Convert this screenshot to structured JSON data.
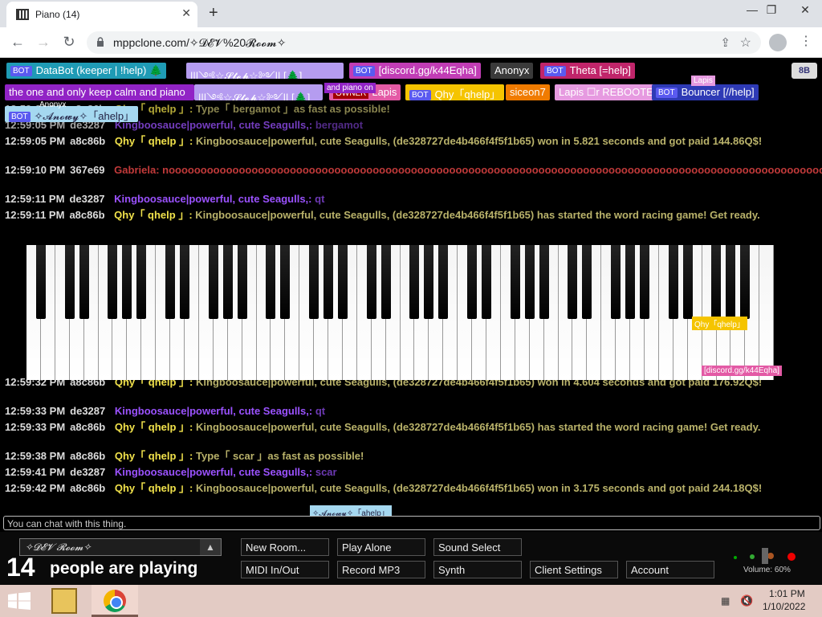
{
  "browser": {
    "tab_title": "Piano (14)",
    "tab_close": "✕",
    "new_tab": "+",
    "minimize": "—",
    "maximize": "❐",
    "close": "✕",
    "back": "←",
    "forward": "→",
    "reload": "↻",
    "url": "mppclone.com/✧𝓓𝓔𝓥%20𝓡𝓸𝓸𝓶✧",
    "share": "⇪",
    "bookmark": "☆",
    "menu": "⋮"
  },
  "players": {
    "databot": "DataBot (keeper | !help) 🌲",
    "step": "|||༺☆𝓢𝓽𝓮𝓹☆༻|| [🌲]",
    "discord": "[discord.gg/k44Eqha]",
    "anonyx": "Anonyx",
    "theta": "Theta [=help]",
    "the_one": "the one and only keep calm and piano",
    "owner_badge": "OWNER",
    "lapis": "Lapis",
    "qhy": "Qhy「qhelp」",
    "siceon": "siceon7",
    "lapis2": "Lapis ☐r REBOOTED",
    "bouncer": "Bouncer [//help]",
    "anowy": "✧𝓐𝓷𝓸𝔀𝔂✧「ahelp」",
    "bot_badge": "BOT",
    "bb": "8B"
  },
  "chat": {
    "lines": [
      {
        "time": "12:59:04 PM",
        "id": "a8c86b",
        "name": "Qhy「 qhelp 」:",
        "text": "Type「 bergamot 」as fast as possible!"
      },
      {
        "time": "12:59:05 PM",
        "id": "de3287",
        "name": "Kingboosauce|powerful, cute Seagulls,:",
        "text": "bergamot"
      },
      {
        "time": "12:59:05 PM",
        "id": "a8c86b",
        "name": "Qhy「 qhelp 」:",
        "text": "Kingboosauce|powerful, cute Seagulls, (de328727de4b466f4f5f1b65) won in 5.821 seconds and got paid 144.86Q$!"
      },
      {
        "time": "12:59:10 PM",
        "id": "367e69",
        "name": "Gabriela:",
        "text": "nooooooooooooooooooooooooooooooooooooooooooooooooooooooooooooooooooooooooooooooooooooooooooooooooooooooooooooo"
      },
      {
        "time": "12:59:11 PM",
        "id": "de3287",
        "name": "Kingboosauce|powerful, cute Seagulls,:",
        "text": "qt"
      },
      {
        "time": "12:59:11 PM",
        "id": "a8c86b",
        "name": "Qhy「 qhelp 」:",
        "text": "Kingboosauce|powerful, cute Seagulls, (de328727de4b466f4f5f1b65) has started the word racing game! Get ready."
      },
      {
        "time": "12:59:32 PM",
        "id": "a8c86b",
        "name": "Qhy「 qhelp 」:",
        "text": "Kingboosauce|powerful, cute Seagulls, (de328727de4b466f4f5f1b65) won in 4.604 seconds and got paid 176.92Q$!"
      },
      {
        "time": "12:59:33 PM",
        "id": "de3287",
        "name": "Kingboosauce|powerful, cute Seagulls,:",
        "text": "qt"
      },
      {
        "time": "12:59:33 PM",
        "id": "a8c86b",
        "name": "Qhy「 qhelp 」:",
        "text": "Kingboosauce|powerful, cute Seagulls, (de328727de4b466f4f5f1b65) has started the word racing game! Get ready."
      },
      {
        "time": "12:59:38 PM",
        "id": "a8c86b",
        "name": "Qhy「 qhelp 」:",
        "text": "Type「 scar 」as fast as possible!"
      },
      {
        "time": "12:59:41 PM",
        "id": "de3287",
        "name": "Kingboosauce|powerful, cute Seagulls,:",
        "text": "scar"
      },
      {
        "time": "12:59:42 PM",
        "id": "a8c86b",
        "name": "Qhy「 qhelp 」:",
        "text": "Kingboosauce|powerful, cute Seagulls, (de328727de4b466f4f5f1b65) won in 3.175 seconds and got paid 244.18Q$!"
      }
    ],
    "input_placeholder": "You can chat with this thing."
  },
  "cursors": {
    "anonyx": "Anonyx",
    "lapis": "Lapis",
    "piano_on": "and piano on",
    "qhy": "Qhy「qhelp」",
    "discord": "[discord.gg/k44Eqha]",
    "anowy": "✧𝓐𝓷𝓸𝔀𝔂✧「ahelp」"
  },
  "controls": {
    "room": "✧𝓓𝓔𝓥 𝓡𝓸𝓸𝓶✧",
    "room_arrow": "▲",
    "people_count": "14",
    "people_text": "people are playing",
    "new_room": "New Room...",
    "play_alone": "Play Alone",
    "sound_select": "Sound Select",
    "midi": "MIDI In/Out",
    "record": "Record MP3",
    "synth": "Synth",
    "client_settings": "Client Settings",
    "account": "Account",
    "volume": "Volume: 60%"
  },
  "taskbar": {
    "time": "1:01 PM",
    "date": "1/10/2022"
  }
}
